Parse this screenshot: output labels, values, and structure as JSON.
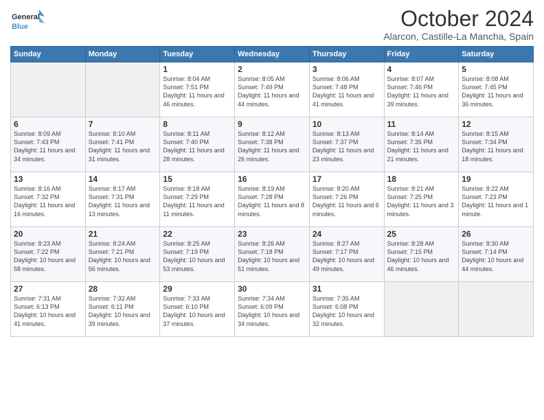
{
  "header": {
    "logo_line1": "General",
    "logo_line2": "Blue",
    "month": "October 2024",
    "location": "Alarcon, Castille-La Mancha, Spain"
  },
  "weekdays": [
    "Sunday",
    "Monday",
    "Tuesday",
    "Wednesday",
    "Thursday",
    "Friday",
    "Saturday"
  ],
  "weeks": [
    [
      {
        "day": "",
        "info": ""
      },
      {
        "day": "",
        "info": ""
      },
      {
        "day": "1",
        "info": "Sunrise: 8:04 AM\nSunset: 7:51 PM\nDaylight: 11 hours and 46 minutes."
      },
      {
        "day": "2",
        "info": "Sunrise: 8:05 AM\nSunset: 7:49 PM\nDaylight: 11 hours and 44 minutes."
      },
      {
        "day": "3",
        "info": "Sunrise: 8:06 AM\nSunset: 7:48 PM\nDaylight: 11 hours and 41 minutes."
      },
      {
        "day": "4",
        "info": "Sunrise: 8:07 AM\nSunset: 7:46 PM\nDaylight: 11 hours and 39 minutes."
      },
      {
        "day": "5",
        "info": "Sunrise: 8:08 AM\nSunset: 7:45 PM\nDaylight: 11 hours and 36 minutes."
      }
    ],
    [
      {
        "day": "6",
        "info": "Sunrise: 8:09 AM\nSunset: 7:43 PM\nDaylight: 11 hours and 34 minutes."
      },
      {
        "day": "7",
        "info": "Sunrise: 8:10 AM\nSunset: 7:41 PM\nDaylight: 11 hours and 31 minutes."
      },
      {
        "day": "8",
        "info": "Sunrise: 8:11 AM\nSunset: 7:40 PM\nDaylight: 11 hours and 28 minutes."
      },
      {
        "day": "9",
        "info": "Sunrise: 8:12 AM\nSunset: 7:38 PM\nDaylight: 11 hours and 26 minutes."
      },
      {
        "day": "10",
        "info": "Sunrise: 8:13 AM\nSunset: 7:37 PM\nDaylight: 11 hours and 23 minutes."
      },
      {
        "day": "11",
        "info": "Sunrise: 8:14 AM\nSunset: 7:35 PM\nDaylight: 11 hours and 21 minutes."
      },
      {
        "day": "12",
        "info": "Sunrise: 8:15 AM\nSunset: 7:34 PM\nDaylight: 11 hours and 18 minutes."
      }
    ],
    [
      {
        "day": "13",
        "info": "Sunrise: 8:16 AM\nSunset: 7:32 PM\nDaylight: 11 hours and 16 minutes."
      },
      {
        "day": "14",
        "info": "Sunrise: 8:17 AM\nSunset: 7:31 PM\nDaylight: 11 hours and 13 minutes."
      },
      {
        "day": "15",
        "info": "Sunrise: 8:18 AM\nSunset: 7:29 PM\nDaylight: 11 hours and 11 minutes."
      },
      {
        "day": "16",
        "info": "Sunrise: 8:19 AM\nSunset: 7:28 PM\nDaylight: 11 hours and 8 minutes."
      },
      {
        "day": "17",
        "info": "Sunrise: 8:20 AM\nSunset: 7:26 PM\nDaylight: 11 hours and 6 minutes."
      },
      {
        "day": "18",
        "info": "Sunrise: 8:21 AM\nSunset: 7:25 PM\nDaylight: 11 hours and 3 minutes."
      },
      {
        "day": "19",
        "info": "Sunrise: 8:22 AM\nSunset: 7:23 PM\nDaylight: 11 hours and 1 minute."
      }
    ],
    [
      {
        "day": "20",
        "info": "Sunrise: 8:23 AM\nSunset: 7:22 PM\nDaylight: 10 hours and 58 minutes."
      },
      {
        "day": "21",
        "info": "Sunrise: 8:24 AM\nSunset: 7:21 PM\nDaylight: 10 hours and 56 minutes."
      },
      {
        "day": "22",
        "info": "Sunrise: 8:25 AM\nSunset: 7:19 PM\nDaylight: 10 hours and 53 minutes."
      },
      {
        "day": "23",
        "info": "Sunrise: 8:26 AM\nSunset: 7:18 PM\nDaylight: 10 hours and 51 minutes."
      },
      {
        "day": "24",
        "info": "Sunrise: 8:27 AM\nSunset: 7:17 PM\nDaylight: 10 hours and 49 minutes."
      },
      {
        "day": "25",
        "info": "Sunrise: 8:28 AM\nSunset: 7:15 PM\nDaylight: 10 hours and 46 minutes."
      },
      {
        "day": "26",
        "info": "Sunrise: 8:30 AM\nSunset: 7:14 PM\nDaylight: 10 hours and 44 minutes."
      }
    ],
    [
      {
        "day": "27",
        "info": "Sunrise: 7:31 AM\nSunset: 6:13 PM\nDaylight: 10 hours and 41 minutes."
      },
      {
        "day": "28",
        "info": "Sunrise: 7:32 AM\nSunset: 6:11 PM\nDaylight: 10 hours and 39 minutes."
      },
      {
        "day": "29",
        "info": "Sunrise: 7:33 AM\nSunset: 6:10 PM\nDaylight: 10 hours and 37 minutes."
      },
      {
        "day": "30",
        "info": "Sunrise: 7:34 AM\nSunset: 6:09 PM\nDaylight: 10 hours and 34 minutes."
      },
      {
        "day": "31",
        "info": "Sunrise: 7:35 AM\nSunset: 6:08 PM\nDaylight: 10 hours and 32 minutes."
      },
      {
        "day": "",
        "info": ""
      },
      {
        "day": "",
        "info": ""
      }
    ]
  ]
}
